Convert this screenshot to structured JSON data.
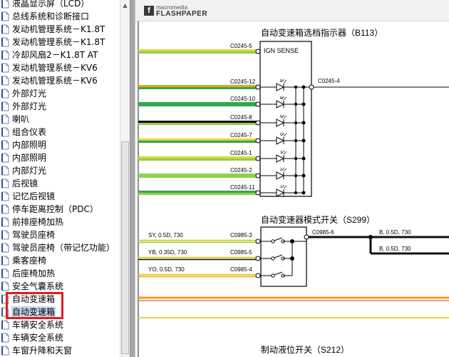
{
  "nav": {
    "items": [
      {
        "label": "液晶显示屏（LCD）"
      },
      {
        "label": "总线系统和诊断接口"
      },
      {
        "label": "发动机管理系统－K1.8T"
      },
      {
        "label": "发动机管理系统－K1.8T"
      },
      {
        "label": "冷却风扇2－K1.8T AT"
      },
      {
        "label": "发动机管理系统－KV6"
      },
      {
        "label": "发动机管理系统－KV6"
      },
      {
        "label": "外部灯光"
      },
      {
        "label": "外部灯光"
      },
      {
        "label": "喇叭"
      },
      {
        "label": "组合仪表"
      },
      {
        "label": "内部照明"
      },
      {
        "label": "内部照明"
      },
      {
        "label": "内部灯光"
      },
      {
        "label": "后视镜"
      },
      {
        "label": "记忆后视镜"
      },
      {
        "label": "停车距离控制（PDC）"
      },
      {
        "label": "前排座椅加热"
      },
      {
        "label": "驾驶员座椅"
      },
      {
        "label": "驾驶员座椅（带记忆功能）"
      },
      {
        "label": "乘客座椅"
      },
      {
        "label": "后座椅加热"
      },
      {
        "label": "安全气囊系统"
      },
      {
        "label": "自动变速箱"
      },
      {
        "label": "自动变速箱",
        "selected": true
      },
      {
        "label": "车辆安全系统"
      },
      {
        "label": "车辆安全系统"
      },
      {
        "label": "车窗升降和天窗"
      }
    ]
  },
  "viewer": {
    "logo_small": "macromedia",
    "logo_big": "FLASHPAPER",
    "logo_icon": "flash-icon"
  },
  "diagram": {
    "title_b113": "自动变速箱选档指示器（B113）",
    "b113_inner": "IGN SENSE",
    "b113_left_connectors": [
      "C0245-5",
      "C0245-12",
      "C0245-10",
      "C0245-8",
      "C0245-7",
      "C0245-1",
      "C0245-2",
      "C0245-11"
    ],
    "b113_right_connector": "C0245-4",
    "b113_led_letters": [
      "P",
      "R",
      "N",
      "D",
      "3",
      "2",
      "1"
    ],
    "title_s299": "自动变速器模式开关（S299）",
    "s299_left_wires": [
      "SY, 0.5D, 730",
      "YB, 0.35D, 730",
      "YO, 0.5D, 730"
    ],
    "s299_left_connectors": [
      "C0985-3",
      "C0985-5",
      "C0985-4"
    ],
    "s299_right_connector": "C0985-6",
    "s299_right_wires": [
      "B, 0.5D, 730",
      "B, 0.5D, 730"
    ],
    "title_s212": "制动液位开关（S212）",
    "wire_colors": {
      "yellow": "#e6d23a",
      "green": "#2fa84f",
      "light_green": "#8fd14f",
      "orange": "#f0a01e",
      "black": "#111111",
      "red": "#d8301e"
    }
  }
}
